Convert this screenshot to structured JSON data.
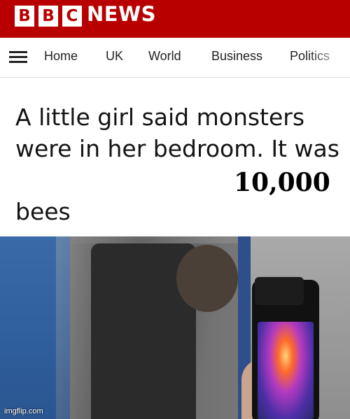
{
  "brand": {
    "letters": [
      "B",
      "B",
      "C"
    ],
    "name": "NEWS"
  },
  "nav": {
    "items": [
      "Home",
      "UK",
      "World",
      "Business",
      "Politics"
    ]
  },
  "headline": {
    "text": "A little girl said monsters were in her bedroom. It was",
    "tail": "bees"
  },
  "overlay": {
    "number": "10,000"
  },
  "watermark": "imgflip.com",
  "colors": {
    "brand_red": "#b80000",
    "nav_bg": "#ffffff",
    "text": "#141414"
  },
  "icons": {
    "menu": "hamburger-menu-icon"
  }
}
